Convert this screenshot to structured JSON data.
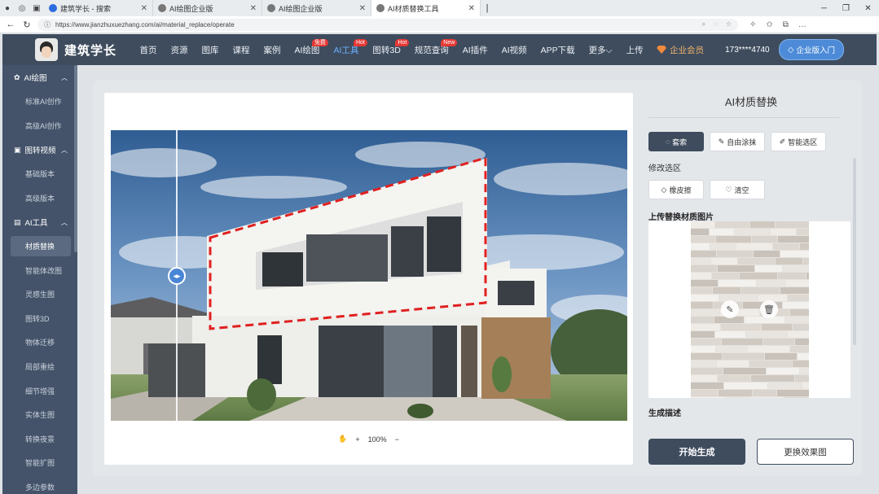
{
  "browser": {
    "tabs": [
      {
        "label": "建筑学长 - 搜索",
        "active": false
      },
      {
        "label": "AI绘图企业版",
        "active": false
      },
      {
        "label": "AI绘图企业版",
        "active": false
      },
      {
        "label": "AI材质替换工具",
        "active": true
      }
    ],
    "url": "https://www.jianzhuxuezhang.com/ai/material_replace/operate"
  },
  "header": {
    "logo_text": "建筑学长",
    "nav": [
      {
        "label": "首页"
      },
      {
        "label": "资源"
      },
      {
        "label": "图库"
      },
      {
        "label": "课程"
      },
      {
        "label": "案例"
      },
      {
        "label": "AI绘图",
        "badge": "免费"
      },
      {
        "label": "AI工具",
        "badge": "Hot",
        "active": true
      },
      {
        "label": "图转3D",
        "badge": "Hot"
      },
      {
        "label": "规范查询",
        "badge": "New"
      },
      {
        "label": "AI插件"
      },
      {
        "label": "AI视频"
      },
      {
        "label": "APP下载"
      },
      {
        "label": "更多⌵"
      },
      {
        "label": "上传"
      }
    ],
    "vip_label": "企业会员",
    "phone": "173****4740",
    "enterprise_button": "企业版入门"
  },
  "sidebar": {
    "groups": [
      {
        "label": "AI绘图",
        "icon": "palette-icon",
        "items": [
          "标准AI创作",
          "高级AI创作"
        ]
      },
      {
        "label": "图转视频",
        "icon": "video-icon",
        "items": [
          "基础版本",
          "高级版本"
        ]
      },
      {
        "label": "AI工具",
        "icon": "toolbox-icon",
        "items": [
          "材质替换",
          "智能体改图",
          "灵感生图",
          "图转3D",
          "物体迁移",
          "局部重绘",
          "细节增强",
          "实体生图",
          "转换夜景",
          "智能扩图",
          "多边参数"
        ]
      }
    ],
    "active_item": "材质替换"
  },
  "canvas": {
    "zoom_label": "100%"
  },
  "panel": {
    "title": "AI材质替换",
    "modes": [
      {
        "label": "套索",
        "icon": "lasso-icon",
        "selected": true
      },
      {
        "label": "自由涂抹",
        "icon": "brush-icon",
        "selected": false
      },
      {
        "label": "智能选区",
        "icon": "magic-icon",
        "selected": false
      }
    ],
    "edit_section_label": "修改选区",
    "edit_tools": [
      {
        "label": "橡皮擦",
        "icon": "eraser-icon"
      },
      {
        "label": "清空",
        "icon": "clear-icon"
      }
    ],
    "upload_section_label": "上传替换材质图片",
    "description_label": "生成描述",
    "generate_button": "开始生成",
    "swap_button": "更换效果图"
  },
  "colors": {
    "header_bg": "#3e4c5e",
    "sidebar_bg": "#44536a",
    "accent_blue": "#4a86d6",
    "selection_red": "#e02020",
    "badge_red": "#e53935"
  }
}
